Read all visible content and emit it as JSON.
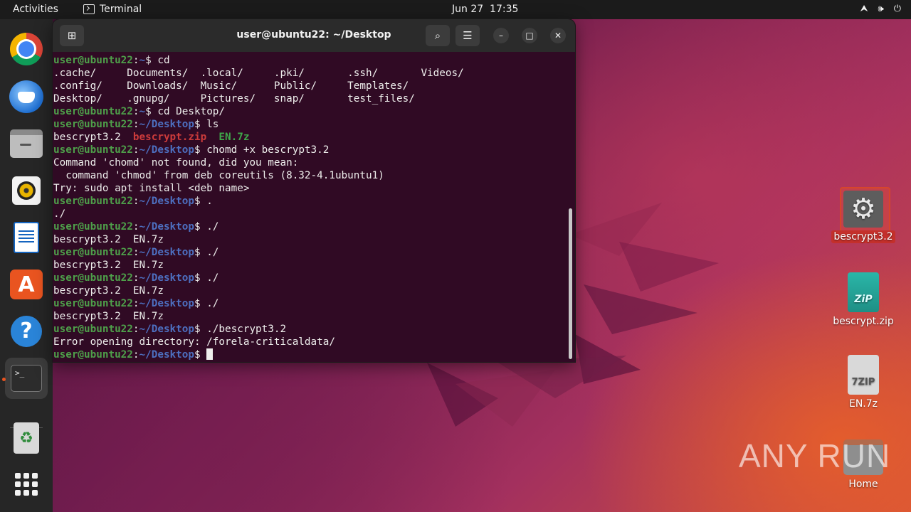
{
  "topbar": {
    "activities": "Activities",
    "app_name": "Terminal",
    "date": "Jun 27",
    "time": "17:35",
    "tray_icons": [
      "network-icon",
      "volume-icon",
      "power-icon"
    ]
  },
  "dock": {
    "items": [
      {
        "name": "Google Chrome",
        "icon": "chrome-icon"
      },
      {
        "name": "Thunderbird Mail",
        "icon": "thunderbird-icon"
      },
      {
        "name": "Files",
        "icon": "files-icon"
      },
      {
        "name": "Rhythmbox",
        "icon": "rhythmbox-icon"
      },
      {
        "name": "LibreOffice Writer",
        "icon": "writer-icon"
      },
      {
        "name": "Ubuntu Software",
        "icon": "software-icon"
      },
      {
        "name": "Help",
        "icon": "help-icon"
      },
      {
        "name": "Terminal",
        "icon": "terminal-icon",
        "running": true
      },
      {
        "name": "Trash",
        "icon": "trash-icon"
      },
      {
        "name": "Show Applications",
        "icon": "app-grid-icon"
      }
    ],
    "terminal_glyph": ">_"
  },
  "terminal": {
    "title": "user@ubuntu22: ~/Desktop",
    "prompt_user": "user@ubuntu22",
    "lines": [
      {
        "type": "prompt",
        "path": "~",
        "cmd": " cd"
      },
      {
        "type": "out",
        "text": ".cache/     Documents/  .local/     .pki/       .ssh/       Videos/"
      },
      {
        "type": "out",
        "text": ".config/    Downloads/  Music/      Public/     Templates/"
      },
      {
        "type": "out",
        "text": "Desktop/    .gnupg/     Pictures/   snap/       test_files/"
      },
      {
        "type": "prompt",
        "path": "~",
        "cmd": " cd Desktop/"
      },
      {
        "type": "prompt",
        "path": "~/Desktop",
        "cmd": " ls"
      },
      {
        "type": "ls",
        "items": [
          [
            "bescrypt3.2",
            "plain"
          ],
          [
            "bescrypt.zip",
            "red"
          ],
          [
            "EN.7z",
            "green"
          ]
        ]
      },
      {
        "type": "prompt",
        "path": "~/Desktop",
        "cmd": " chomd +x bescrypt3.2"
      },
      {
        "type": "out",
        "text": "Command 'chomd' not found, did you mean:"
      },
      {
        "type": "out",
        "text": "  command 'chmod' from deb coreutils (8.32-4.1ubuntu1)"
      },
      {
        "type": "out",
        "text": "Try: sudo apt install <deb name>"
      },
      {
        "type": "prompt",
        "path": "~/Desktop",
        "cmd": " ."
      },
      {
        "type": "out",
        "text": "./"
      },
      {
        "type": "prompt",
        "path": "~/Desktop",
        "cmd": " ./"
      },
      {
        "type": "out",
        "text": "bescrypt3.2  EN.7z"
      },
      {
        "type": "prompt",
        "path": "~/Desktop",
        "cmd": " ./"
      },
      {
        "type": "out",
        "text": "bescrypt3.2  EN.7z"
      },
      {
        "type": "prompt",
        "path": "~/Desktop",
        "cmd": " ./"
      },
      {
        "type": "out",
        "text": "bescrypt3.2  EN.7z"
      },
      {
        "type": "prompt",
        "path": "~/Desktop",
        "cmd": " ./"
      },
      {
        "type": "out",
        "text": "bescrypt3.2  EN.7z"
      },
      {
        "type": "prompt",
        "path": "~/Desktop",
        "cmd": " ./bescrypt3.2"
      },
      {
        "type": "out",
        "text": "Error opening directory: /forela-criticaldata/"
      },
      {
        "type": "prompt",
        "path": "~/Desktop",
        "cmd": " ",
        "cursor": true
      }
    ],
    "colors": {
      "background": "#300a24",
      "user": "#4ea04a",
      "path": "#4d6fc0",
      "archive_red": "#cc3b3b",
      "archive_green": "#3fa84a"
    }
  },
  "desktop": {
    "icons": [
      {
        "label": "bescrypt3.2",
        "icon": "executable-gear-icon",
        "selected": true
      },
      {
        "label": "bescrypt.zip",
        "icon": "zip-archive-icon",
        "badge": "ZiP"
      },
      {
        "label": "EN.7z",
        "icon": "7z-archive-icon",
        "badge": "7ZIP"
      },
      {
        "label": "Home",
        "icon": "home-folder-icon"
      }
    ]
  },
  "watermark": {
    "text": "ANY RUN"
  }
}
